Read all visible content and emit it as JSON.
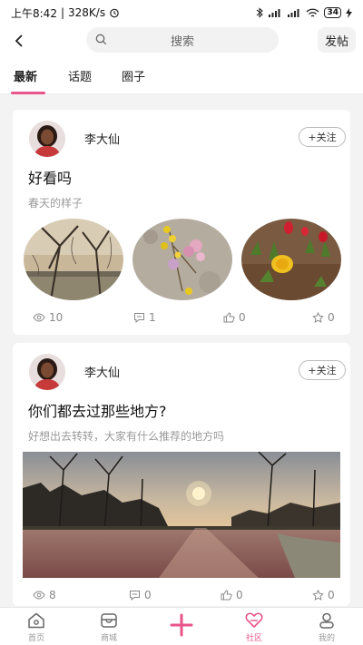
{
  "status_bar": {
    "time": "上午8:42",
    "speed": "328K/s",
    "battery": "34"
  },
  "header": {
    "search_placeholder": "搜索",
    "post_label": "发帖"
  },
  "tabs": [
    {
      "label": "最新",
      "active": true
    },
    {
      "label": "话题",
      "active": false
    },
    {
      "label": "圈子",
      "active": false
    }
  ],
  "posts": [
    {
      "author": "李大仙",
      "follow_label": "+关注",
      "title": "好看吗",
      "subtitle": "春天的样子",
      "views": "10",
      "comments": "1",
      "likes": "0",
      "stars": "0"
    },
    {
      "author": "李大仙",
      "follow_label": "+关注",
      "title": "你们都去过那些地方?",
      "subtitle": "好想出去转转，大家有什么推荐的地方吗",
      "views": "8",
      "comments": "0",
      "likes": "0",
      "stars": "0"
    }
  ],
  "tabbar": [
    {
      "label": "首页",
      "icon": "home-icon"
    },
    {
      "label": "商城",
      "icon": "shop-icon"
    },
    {
      "label": "",
      "icon": "plus-icon"
    },
    {
      "label": "社区",
      "icon": "community-icon"
    },
    {
      "label": "我的",
      "icon": "profile-icon"
    }
  ],
  "colors": {
    "accent": "#e8558a",
    "background": "#f3f3f3"
  }
}
